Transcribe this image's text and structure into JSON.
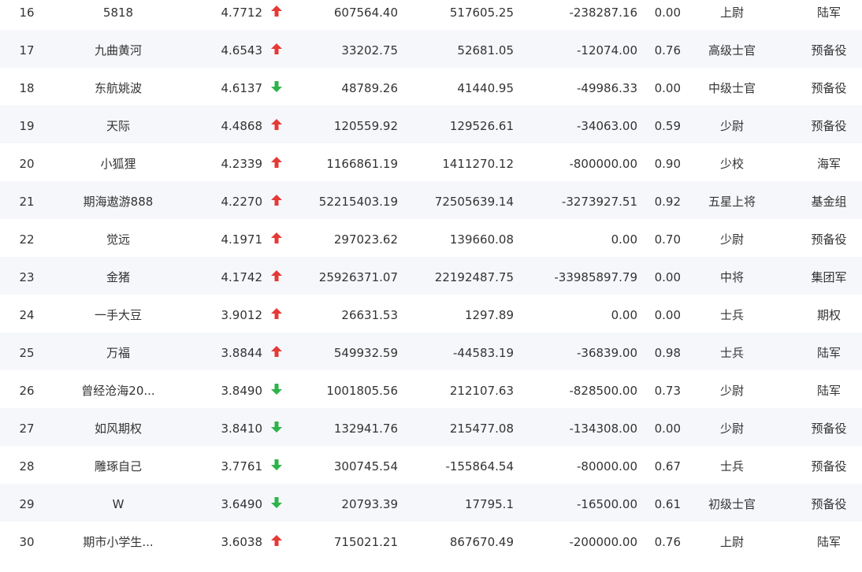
{
  "colors": {
    "up": "#e53935",
    "down": "#2db34a",
    "stripe": "#f5f7fa",
    "text": "#333333"
  },
  "rows": [
    {
      "rank": "16",
      "name": "5818",
      "score": "4.7712",
      "trend": "up",
      "v1": "607564.40",
      "v2": "517605.25",
      "v3": "-238287.16",
      "ratio": "0.00",
      "level": "上尉",
      "group": "陆军"
    },
    {
      "rank": "17",
      "name": "九曲黄河",
      "score": "4.6543",
      "trend": "up",
      "v1": "33202.75",
      "v2": "52681.05",
      "v3": "-12074.00",
      "ratio": "0.76",
      "level": "高级士官",
      "group": "预备役"
    },
    {
      "rank": "18",
      "name": "东航姚波",
      "score": "4.6137",
      "trend": "down",
      "v1": "48789.26",
      "v2": "41440.95",
      "v3": "-49986.33",
      "ratio": "0.00",
      "level": "中级士官",
      "group": "预备役"
    },
    {
      "rank": "19",
      "name": "天际",
      "score": "4.4868",
      "trend": "up",
      "v1": "120559.92",
      "v2": "129526.61",
      "v3": "-34063.00",
      "ratio": "0.59",
      "level": "少尉",
      "group": "预备役"
    },
    {
      "rank": "20",
      "name": "小狐狸",
      "score": "4.2339",
      "trend": "up",
      "v1": "1166861.19",
      "v2": "1411270.12",
      "v3": "-800000.00",
      "ratio": "0.90",
      "level": "少校",
      "group": "海军"
    },
    {
      "rank": "21",
      "name": "期海遨游888",
      "score": "4.2270",
      "trend": "up",
      "v1": "52215403.19",
      "v2": "72505639.14",
      "v3": "-3273927.51",
      "ratio": "0.92",
      "level": "五星上将",
      "group": "基金组"
    },
    {
      "rank": "22",
      "name": "觉远",
      "score": "4.1971",
      "trend": "up",
      "v1": "297023.62",
      "v2": "139660.08",
      "v3": "0.00",
      "ratio": "0.70",
      "level": "少尉",
      "group": "预备役"
    },
    {
      "rank": "23",
      "name": "金猪",
      "score": "4.1742",
      "trend": "up",
      "v1": "25926371.07",
      "v2": "22192487.75",
      "v3": "-33985897.79",
      "ratio": "0.00",
      "level": "中将",
      "group": "集团军"
    },
    {
      "rank": "24",
      "name": "一手大豆",
      "score": "3.9012",
      "trend": "up",
      "v1": "26631.53",
      "v2": "1297.89",
      "v3": "0.00",
      "ratio": "0.00",
      "level": "士兵",
      "group": "期权"
    },
    {
      "rank": "25",
      "name": "万福",
      "score": "3.8844",
      "trend": "up",
      "v1": "549932.59",
      "v2": "-44583.19",
      "v3": "-36839.00",
      "ratio": "0.98",
      "level": "士兵",
      "group": "陆军"
    },
    {
      "rank": "26",
      "name": "曾经沧海20...",
      "score": "3.8490",
      "trend": "down",
      "v1": "1001805.56",
      "v2": "212107.63",
      "v3": "-828500.00",
      "ratio": "0.73",
      "level": "少尉",
      "group": "陆军"
    },
    {
      "rank": "27",
      "name": "如风期权",
      "score": "3.8410",
      "trend": "down",
      "v1": "132941.76",
      "v2": "215477.08",
      "v3": "-134308.00",
      "ratio": "0.00",
      "level": "少尉",
      "group": "预备役"
    },
    {
      "rank": "28",
      "name": "雕琢自己",
      "score": "3.7761",
      "trend": "down",
      "v1": "300745.54",
      "v2": "-155864.54",
      "v3": "-80000.00",
      "ratio": "0.67",
      "level": "士兵",
      "group": "预备役"
    },
    {
      "rank": "29",
      "name": "W",
      "score": "3.6490",
      "trend": "down",
      "v1": "20793.39",
      "v2": "17795.1",
      "v3": "-16500.00",
      "ratio": "0.61",
      "level": "初级士官",
      "group": "预备役"
    },
    {
      "rank": "30",
      "name": "期市小学生...",
      "score": "3.6038",
      "trend": "up",
      "v1": "715021.21",
      "v2": "867670.49",
      "v3": "-200000.00",
      "ratio": "0.76",
      "level": "上尉",
      "group": "陆军"
    }
  ]
}
